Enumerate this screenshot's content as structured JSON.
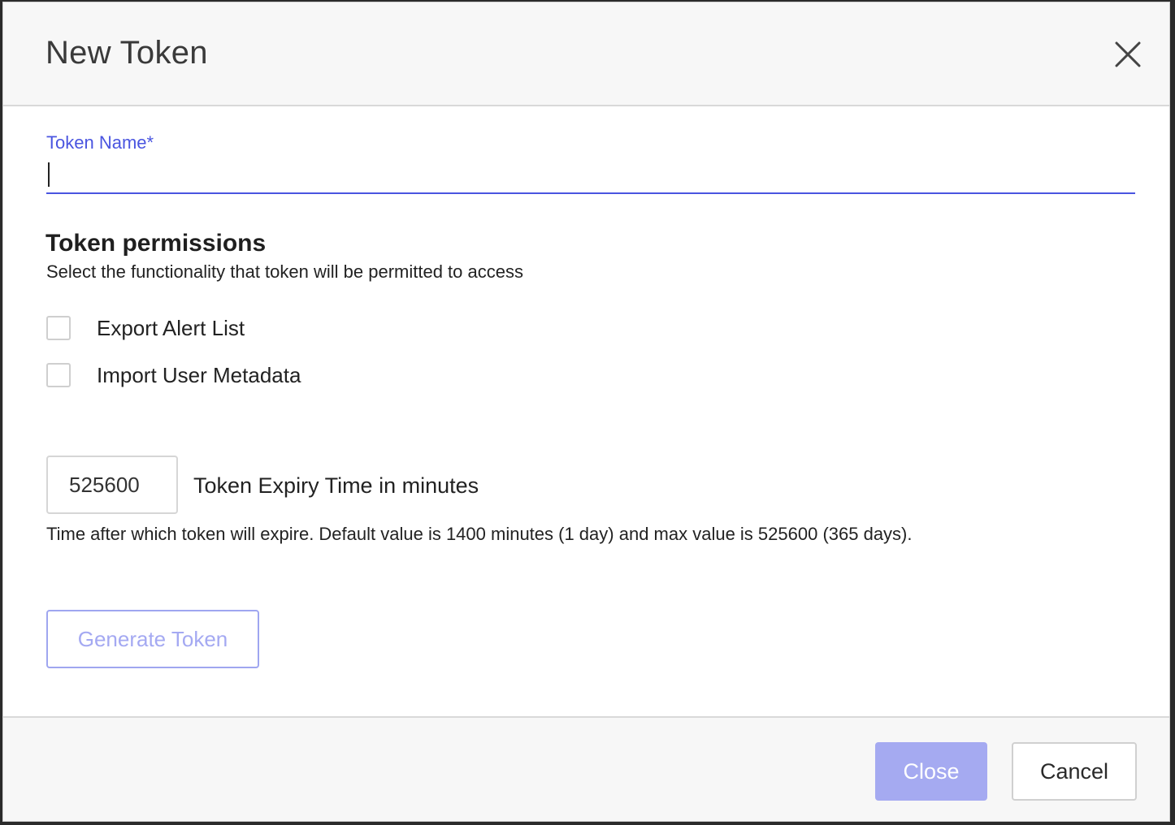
{
  "dialog": {
    "title": "New Token",
    "close_icon": "close-icon"
  },
  "token_name": {
    "label": "Token Name*",
    "value": "",
    "accent_color": "#4a55e0"
  },
  "permissions": {
    "title": "Token permissions",
    "subtitle": "Select the functionality that token will be permitted to access",
    "items": [
      {
        "label": "Export Alert List",
        "checked": false
      },
      {
        "label": "Import User Metadata",
        "checked": false
      }
    ]
  },
  "expiry": {
    "value": "525600",
    "label": "Token Expiry Time in minutes",
    "help": "Time after which token will expire. Default value is 1400 minutes (1 day) and max value is 525600 (365 days)."
  },
  "actions": {
    "generate_label": "Generate Token",
    "close_label": "Close",
    "cancel_label": "Cancel",
    "primary_disabled_color": "#a5aaf1"
  }
}
